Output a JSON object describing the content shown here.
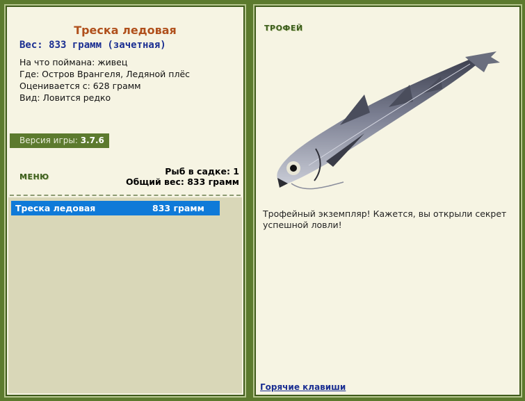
{
  "left": {
    "title": "Треска ледовая",
    "weight": "Вес: 833 грамм (зачетная)",
    "info": [
      "На что поймана: живец",
      "Где: Остров Врангеля, Ледяной плёс",
      "Оценивается с: 628 грамм",
      "Вид: Ловится редко"
    ],
    "version_label": "Версия игры:",
    "version_value": "3.7.6",
    "menu_label": "МЕНЮ",
    "fish_count": "Рыб в садке: 1",
    "total_weight": "Общий вес: 833 грамм",
    "catch_list": [
      {
        "name": "Треска ледовая",
        "weight": "833 грамм"
      }
    ]
  },
  "right": {
    "trophy_label": "ТРОФЕЙ",
    "trophy_text": "Трофейный экземпляр! Кажется, вы открыли секрет успешной ловли!",
    "hotkeys": "Горячие клавиши"
  },
  "colors": {
    "frame": "#5c7a2e",
    "panel_bg": "#f6f4e3",
    "title": "#b0501c",
    "weight": "#1b2f92",
    "selected": "#0f7ad8",
    "list_bg": "#d9d7b8"
  },
  "icons": {
    "fish_image": "cod-fish-image"
  }
}
